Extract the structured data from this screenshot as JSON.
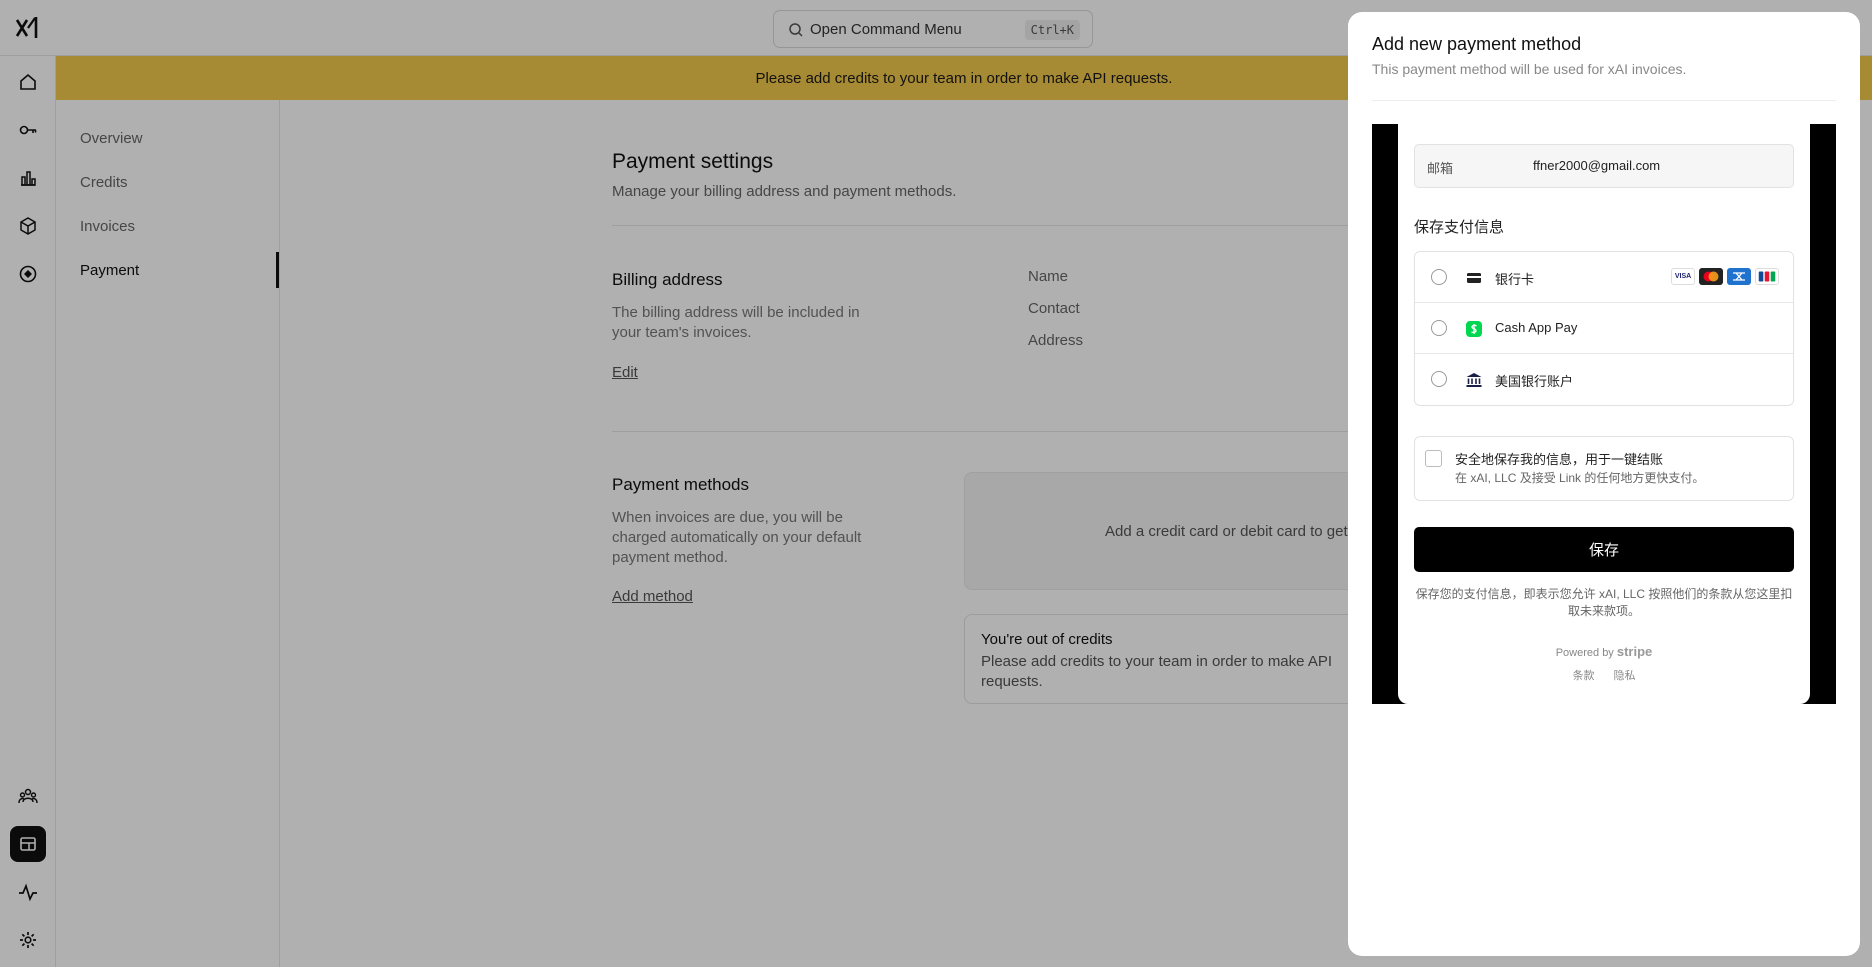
{
  "command_menu": {
    "label": "Open Command Menu",
    "shortcut": "Ctrl+K"
  },
  "banner": {
    "text": "Please add credits to your team in order to make API requests.",
    "color": "#f2c94c"
  },
  "subnav": {
    "items": [
      {
        "label": "Overview"
      },
      {
        "label": "Credits"
      },
      {
        "label": "Invoices"
      },
      {
        "label": "Payment"
      }
    ]
  },
  "rail": {
    "top_icons": [
      "home-icon",
      "key-icon",
      "bar-chart-icon",
      "cube-icon",
      "target-icon"
    ],
    "bottom_icons": [
      "team-icon",
      "billing-icon",
      "activity-icon",
      "settings-icon"
    ]
  },
  "page": {
    "title": "Payment settings",
    "subtitle": "Manage your billing address and payment methods.",
    "billing": {
      "title": "Billing address",
      "description": "The billing address will be included in your team's invoices.",
      "edit_label": "Edit",
      "fields": [
        "Name",
        "Contact",
        "Address"
      ]
    },
    "methods": {
      "title": "Payment methods",
      "description": "When invoices are due, you will be charged automatically on your default payment method.",
      "add_label": "Add method",
      "empty_text": "Add a credit card or debit card to get",
      "alert_title": "You're out of credits",
      "alert_text": "Please add credits to your team in order to make API requests."
    }
  },
  "panel": {
    "title": "Add new payment method",
    "subtitle": "This payment method will be used for xAI invoices.",
    "stripe": {
      "email_label": "邮箱",
      "email_value": "ffner2000@gmail.com",
      "save_info_title": "保存支付信息",
      "methods": [
        {
          "label": "银行卡",
          "icon": "card-icon"
        },
        {
          "label": "Cash App Pay",
          "icon": "cash-app-icon"
        },
        {
          "label": "美国银行账户",
          "icon": "bank-icon"
        }
      ],
      "brands": [
        "VISA",
        "MC",
        "AMEX",
        "JCB"
      ],
      "link_title": "安全地保存我的信息，用于一键结账",
      "link_desc": "在 xAI, LLC 及接受 Link 的任何地方更快支付。",
      "save_button": "保存",
      "legal": "保存您的支付信息，即表示您允许 xAI, LLC 按照他们的条款从您这里扣取未来款项。",
      "powered_by": "Powered by",
      "powered_brand": "stripe",
      "terms": "条款",
      "privacy": "隐私"
    }
  }
}
